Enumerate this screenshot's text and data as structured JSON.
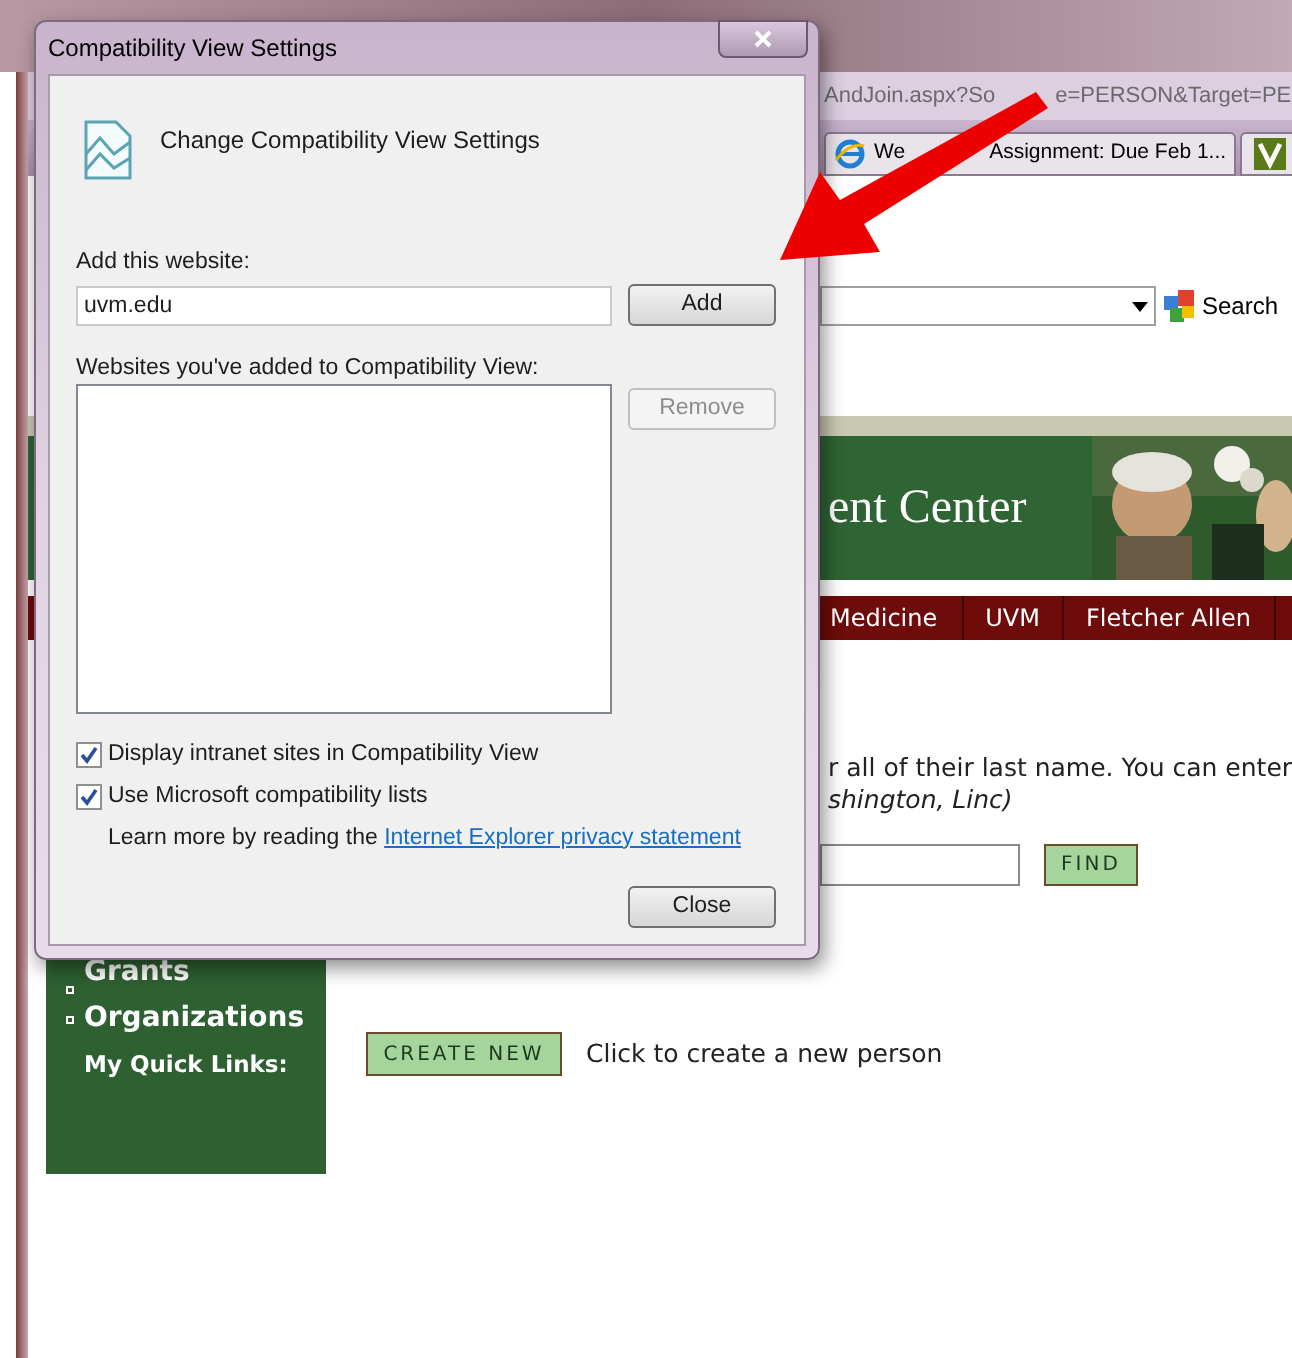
{
  "browser": {
    "address": [
      "AndJoin.aspx?So",
      "e=PERSON&Target=PE"
    ],
    "tab": {
      "label": [
        "We",
        "Assignment: Due Feb 1..."
      ]
    },
    "search_button": "Search"
  },
  "banner": {
    "title": "ent Center"
  },
  "nav": [
    "Medicine",
    "UVM",
    "Fletcher Allen"
  ],
  "sidebar": {
    "items": [
      {
        "label": "Grants",
        "kind": "link"
      },
      {
        "label": "Organizations",
        "kind": "link"
      },
      {
        "label": "My Quick Links:",
        "kind": "heading"
      }
    ]
  },
  "instructions": [
    {
      "text": "r all of their last name. You can enter",
      "italic": false
    },
    {
      "text": "shington, Linc)",
      "italic": true
    }
  ],
  "find_button": "FIND",
  "create_button": "CREATE NEW",
  "create_hint": "Click to create a new person",
  "dialog": {
    "title": "Compatibility View Settings",
    "heading": "Change Compatibility View Settings",
    "add_label": "Add this website:",
    "website_value": "uvm.edu",
    "add_button": "Add",
    "list_label": "Websites you've added to Compatibility View:",
    "remove_button": {
      "label": "Remove",
      "disabled": true
    },
    "options": [
      {
        "label": "Display intranet sites in Compatibility View",
        "checked": true
      },
      {
        "label": "Use Microsoft compatibility lists",
        "checked": true
      }
    ],
    "learn_more": {
      "text": "Learn more by reading the",
      "link": "Internet Explorer privacy statement"
    },
    "close_button": "Close"
  }
}
